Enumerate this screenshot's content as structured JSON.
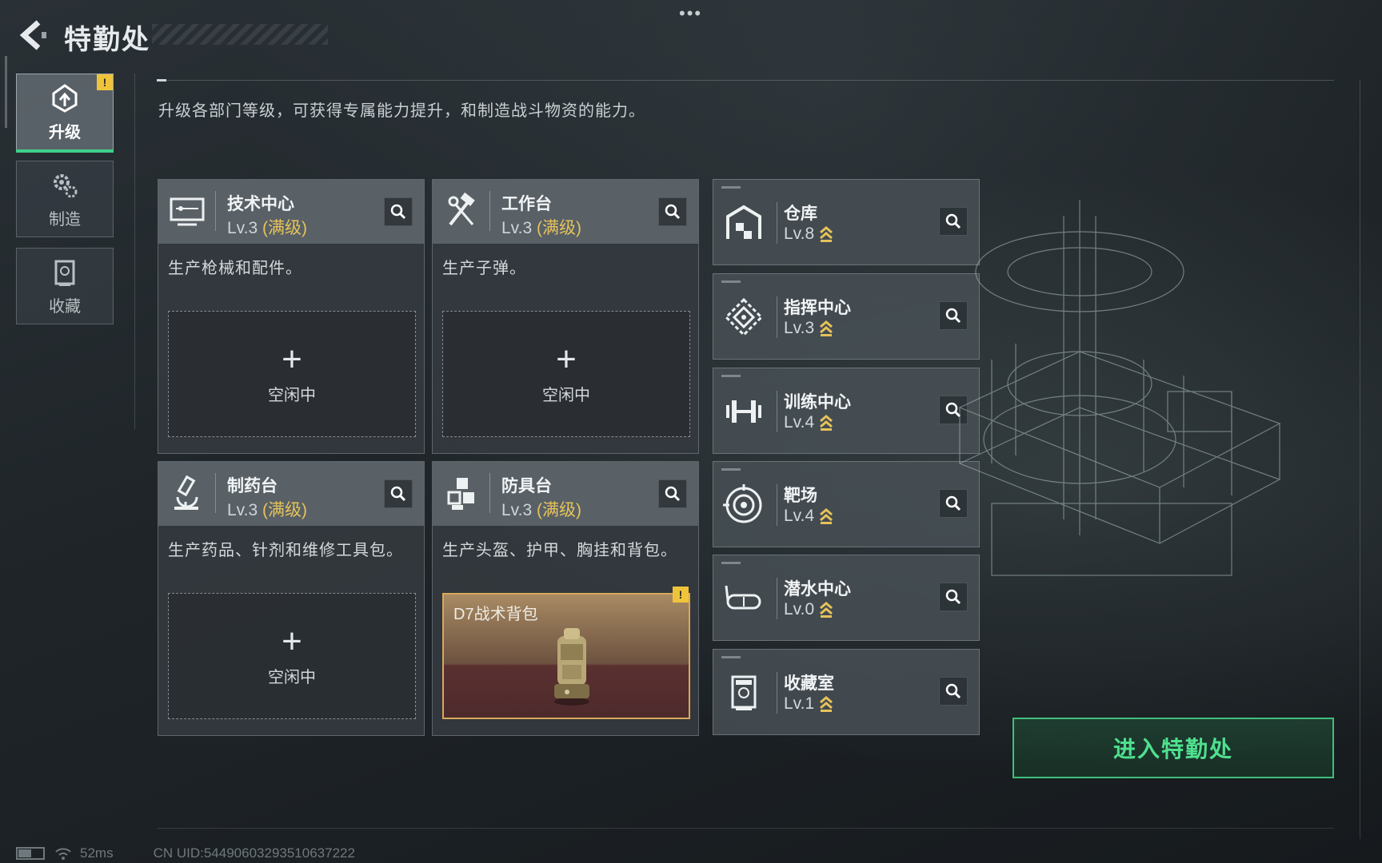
{
  "header": {
    "title": "特勤处",
    "more_icon": "more-dots-icon",
    "subtitle": "升级各部门等级，可获得专属能力提升，和制造战斗物资的能力。"
  },
  "nav": {
    "items": [
      {
        "label": "升级",
        "icon": "upgrade-icon",
        "active": true,
        "badge": "!"
      },
      {
        "label": "制造",
        "icon": "gears-icon",
        "active": false
      },
      {
        "label": "收藏",
        "icon": "collection-icon",
        "active": false
      }
    ]
  },
  "departments": [
    {
      "name": "技术中心",
      "level": "Lv.3",
      "level_note": "(满级)",
      "desc": "生产枪械和配件。",
      "slot_label": "空闲中",
      "icon": "monitor-icon"
    },
    {
      "name": "工作台",
      "level": "Lv.3",
      "level_note": "(满级)",
      "desc": "生产子弹。",
      "slot_label": "空闲中",
      "icon": "hammer-wrench-icon"
    },
    {
      "name": "制药台",
      "level": "Lv.3",
      "level_note": "(满级)",
      "desc": "生产药品、针剂和维修工具包。",
      "slot_label": "空闲中",
      "icon": "microscope-icon"
    },
    {
      "name": "防具台",
      "level": "Lv.3",
      "level_note": "(满级)",
      "desc": "生产头盔、护甲、胸挂和背包。",
      "craft_item": "D7战术背包",
      "craft_badge": "!",
      "icon": "cubes-icon"
    }
  ],
  "facilities": [
    {
      "name": "仓库",
      "level": "Lv.8",
      "icon": "warehouse-icon"
    },
    {
      "name": "指挥中心",
      "level": "Lv.3",
      "icon": "command-icon"
    },
    {
      "name": "训练中心",
      "level": "Lv.4",
      "icon": "dumbbell-icon"
    },
    {
      "name": "靶场",
      "level": "Lv.4",
      "icon": "target-icon"
    },
    {
      "name": "潜水中心",
      "level": "Lv.0",
      "icon": "diving-mask-icon"
    },
    {
      "name": "收藏室",
      "level": "Lv.1",
      "icon": "display-case-icon"
    }
  ],
  "enter_button": "进入特勤处",
  "status": {
    "ping": "52ms",
    "uid": "CN UID:5449060329351063​7222"
  },
  "colors": {
    "accent_green": "#3fc07c",
    "max_level_gold": "#e6c25a",
    "badge_yellow": "#f0c43a"
  }
}
